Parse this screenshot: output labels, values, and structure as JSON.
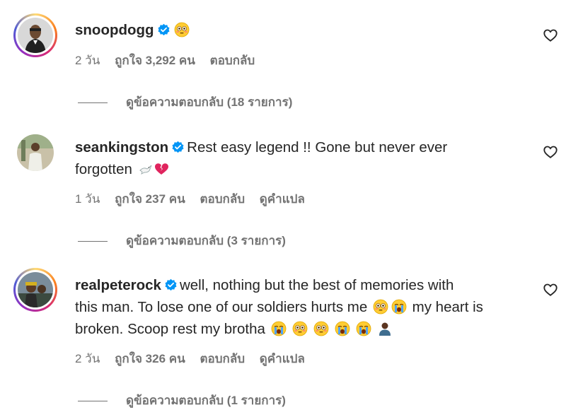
{
  "comments": [
    {
      "username": "snoopdogg",
      "text": "",
      "time": "2 วัน",
      "likes": "ถูกใจ 3,292 คน",
      "reply": "ตอบกลับ",
      "translate": "",
      "view_replies": "ดูข้อความตอบกลับ (18 รายการ)",
      "emojis": [
        "flushed-face"
      ]
    },
    {
      "username": "seankingston",
      "text_line1": "Rest easy legend !! Gone but never ever",
      "text_line2": "forgotten",
      "time": "1 วัน",
      "likes": "ถูกใจ 237 คน",
      "reply": "ตอบกลับ",
      "translate": "ดูคำแปล",
      "view_replies": "ดูข้อความตอบกลับ (3 รายการ)",
      "emojis": [
        "dove",
        "broken-heart"
      ]
    },
    {
      "username": "realpeterock",
      "text_line1": "well, nothing but the best of memories with",
      "text_line2": "this man. To lose one of our soldiers hurts me",
      "text_line3": "my heart is",
      "text_line4": "broken. Scoop rest my brotha",
      "time": "2 วัน",
      "likes": "ถูกใจ 326 คน",
      "reply": "ตอบกลับ",
      "translate": "ดูคำแปล",
      "view_replies": "ดูข้อความตอบกลับ (1 รายการ)",
      "emojis": [
        "flushed-face",
        "crying-face",
        "crying-face",
        "flushed-face",
        "flushed-face",
        "crying-face",
        "crying-face",
        "person"
      ]
    }
  ],
  "colors": {
    "text": "#262626",
    "secondary": "#737373",
    "verified": "#0095f6",
    "broken_heart": "#e0245e"
  }
}
